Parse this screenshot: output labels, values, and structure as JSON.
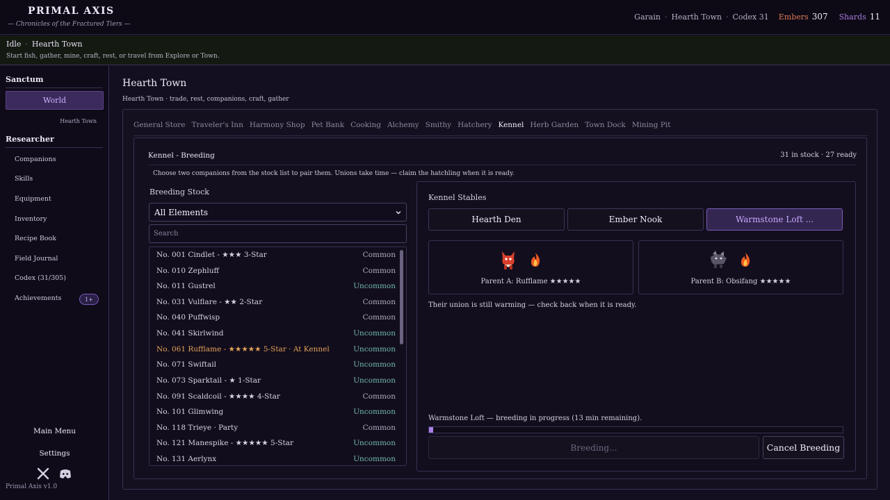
{
  "header": {
    "title": "PRIMAL AXIS",
    "subtitle": "— Chronicles of the Fractured Tiers —",
    "breadcrumb": [
      "Garain",
      "Hearth Town",
      "Codex 31"
    ],
    "embers_label": "Embers",
    "embers_value": "307",
    "shards_label": "Shards",
    "shards_value": "11"
  },
  "status": {
    "state": "Idle",
    "location": "Hearth Town",
    "hint": "Start fish, gather, mine, craft, rest, or travel from Explore or Town."
  },
  "sidebar": {
    "section1": "Sanctum",
    "world_button": "World",
    "world_sub": "Hearth Town",
    "section2": "Researcher",
    "items": [
      "Companions",
      "Skills",
      "Equipment",
      "Inventory",
      "Recipe Book",
      "Field Journal",
      "Codex (31/305)",
      "Achievements"
    ],
    "achievements_badge": "1+",
    "main_menu": "Main Menu",
    "settings": "Settings",
    "version": "Primal Axis  v1.0"
  },
  "main": {
    "title": "Hearth Town",
    "subtitle": "Hearth Town · trade, rest, companions, craft, gather",
    "tabs": [
      "General Store",
      "Traveler's Inn",
      "Harmony Shop",
      "Pet Bank",
      "Cooking",
      "Alchemy",
      "Smithy",
      "Hatchery",
      "Kennel",
      "Herb Garden",
      "Town Dock",
      "Mining Pit"
    ],
    "active_tab": "Kennel"
  },
  "kennel": {
    "title": "Kennel - Breeding",
    "stock_summary": "31 in stock · 27 ready",
    "description": "Choose two companions from the stock list to pair them. Unions take time — claim the hatchling when it is ready.",
    "stock_title": "Breeding Stock",
    "filter_value": "All Elements",
    "search_placeholder": "Search",
    "stock": [
      {
        "name": "No. 001 Cindlet - ★★★ 3-Star",
        "rarity": "Common"
      },
      {
        "name": "No. 010 Zephluff",
        "rarity": "Common"
      },
      {
        "name": "No. 011 Gustrel",
        "rarity": "Uncommon"
      },
      {
        "name": "No. 031 Vulflare - ★★ 2-Star",
        "rarity": "Common"
      },
      {
        "name": "No. 040 Puffwisp",
        "rarity": "Common"
      },
      {
        "name": "No. 041 Skirlwind",
        "rarity": "Uncommon"
      },
      {
        "name": "No. 061 Rufflame - ★★★★★ 5-Star · At Kennel",
        "rarity": "Uncommon",
        "highlight": true
      },
      {
        "name": "No. 071 Swiftail",
        "rarity": "Uncommon"
      },
      {
        "name": "No. 073 Sparktail - ★ 1-Star",
        "rarity": "Uncommon"
      },
      {
        "name": "No. 091 Scaldcoil - ★★★★ 4-Star",
        "rarity": "Common"
      },
      {
        "name": "No. 101 Glimwing",
        "rarity": "Uncommon"
      },
      {
        "name": "No. 118 Trieye · Party",
        "rarity": "Common"
      },
      {
        "name": "No. 121 Manespike - ★★★★★ 5-Star",
        "rarity": "Uncommon"
      },
      {
        "name": "No. 131 Aerlynx",
        "rarity": "Uncommon"
      }
    ],
    "stables_title": "Kennel Stables",
    "stables": [
      "Hearth Den",
      "Ember Nook",
      "Warmstone Loft ..."
    ],
    "active_stable": "Warmstone Loft ...",
    "parent_a": "Parent A: Rufflame ★★★★★",
    "parent_b": "Parent B: Obsifang ★★★★★",
    "union_message": "Their union is still warming — check back when it is ready.",
    "progress_text": "Warmstone Loft — breeding in progress (13 min remaining).",
    "progress_fraction": 0.01,
    "breed_button": "Breeding...",
    "cancel_button": "Cancel Breeding"
  },
  "colors": {
    "accent": "#a77fe6",
    "embers": "#e07a5a",
    "uncommon": "#6fb8b0",
    "highlight": "#e3a35a"
  }
}
